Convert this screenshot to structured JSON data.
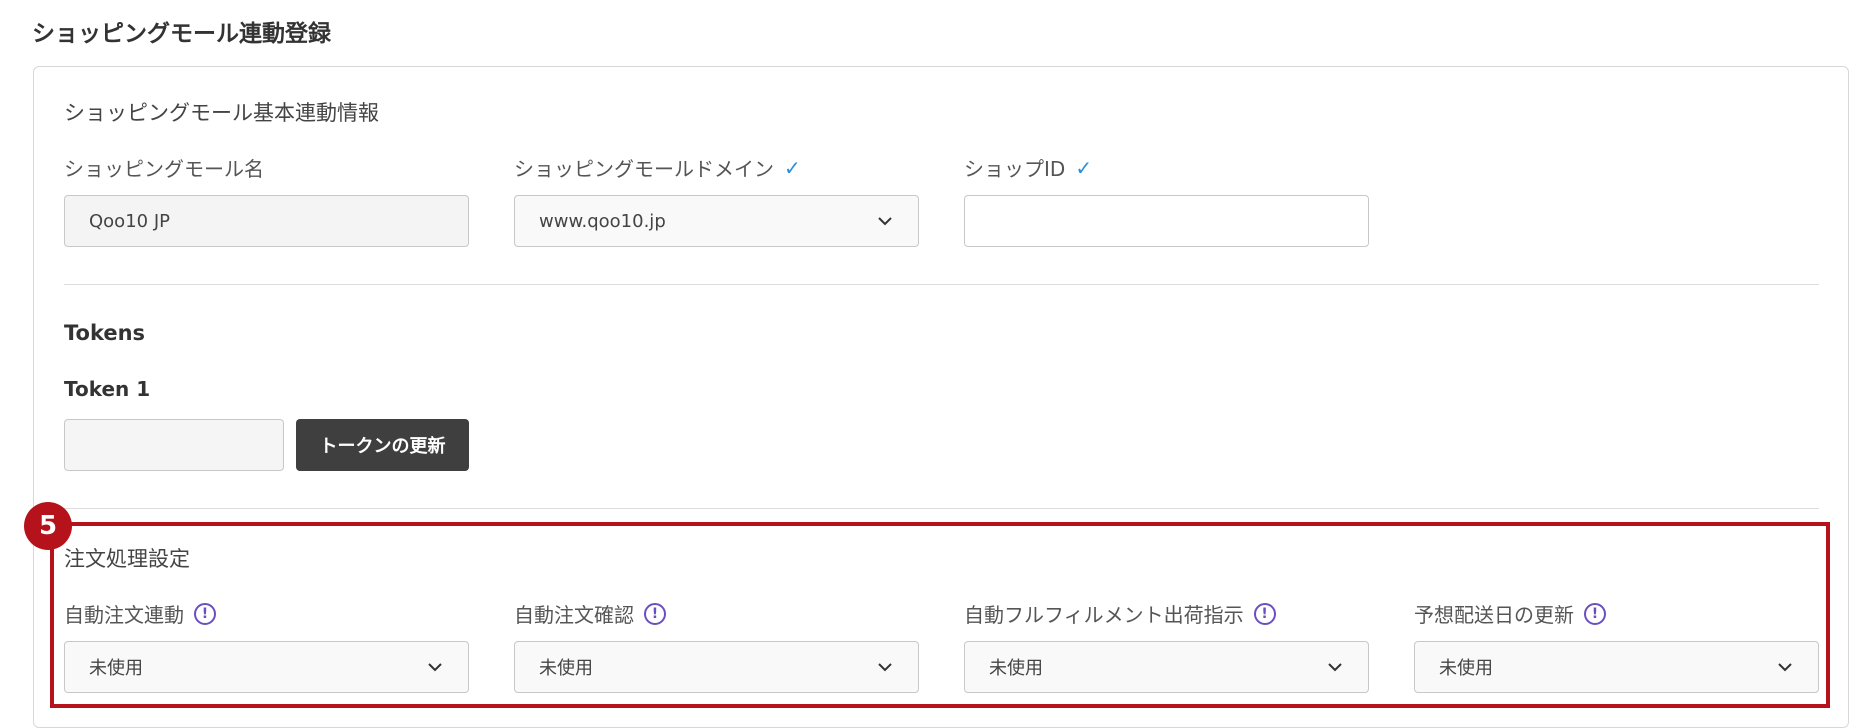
{
  "page_title": "ショッピングモール連動登録",
  "basic_section": {
    "title": "ショッピングモール基本連動情報",
    "mall_name_label": "ショッピングモール名",
    "mall_name_value": "Qoo10 JP",
    "domain_label": "ショッピングモールドメイン",
    "domain_value": "www.qoo10.jp",
    "shop_id_label": "ショップID",
    "shop_id_value": ""
  },
  "tokens_section": {
    "title": "Tokens",
    "token1_label": "Token 1",
    "token1_value": "",
    "refresh_button": "トークンの更新"
  },
  "step_badge": "5",
  "order_section": {
    "title": "注文処理設定",
    "fields": [
      {
        "label": "自動注文連動",
        "value": "未使用"
      },
      {
        "label": "自動注文確認",
        "value": "未使用"
      },
      {
        "label": "自動フルフィルメント出荷指示",
        "value": "未使用"
      },
      {
        "label": "予想配送日の更新",
        "value": "未使用"
      }
    ]
  },
  "colors": {
    "accent_check": "#2a8fd8",
    "info_icon": "#6b4fc2",
    "highlight": "#b5121b",
    "dark_button": "#3f3f3f"
  }
}
